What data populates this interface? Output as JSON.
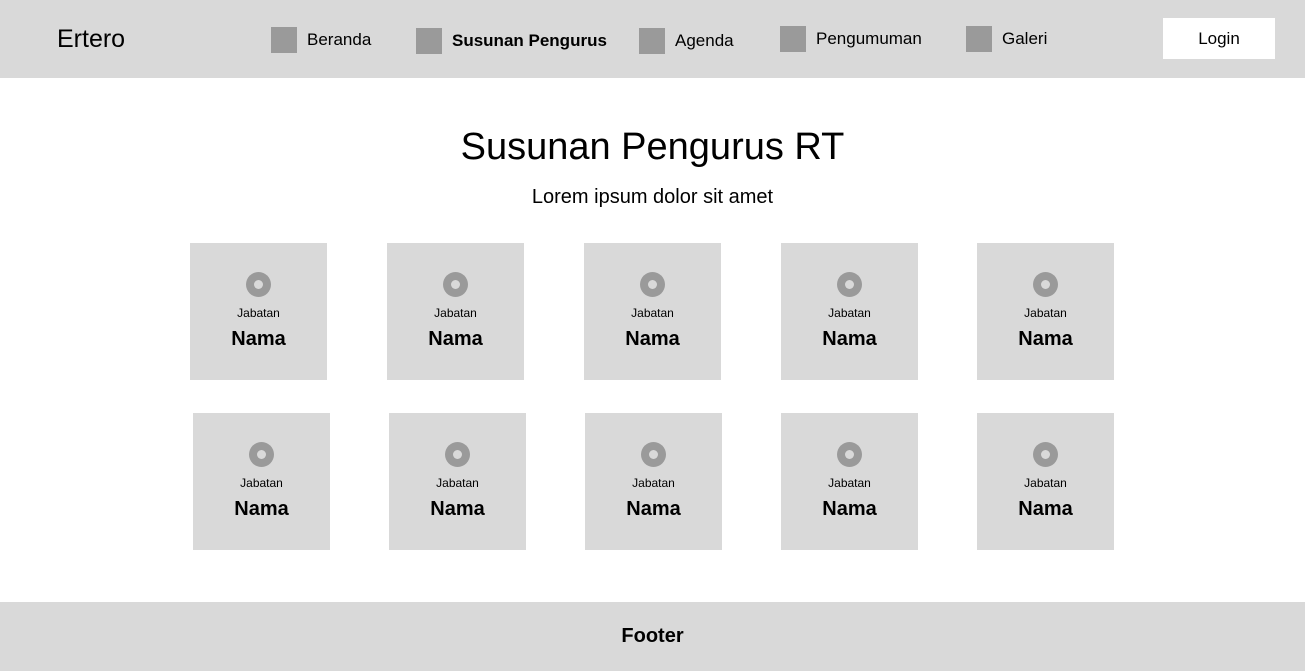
{
  "header": {
    "brand": "Ertero",
    "nav": [
      {
        "label": "Beranda",
        "icon": "placeholder-square-icon",
        "active": false
      },
      {
        "label": "Susunan Pengurus",
        "icon": "placeholder-square-icon",
        "active": true
      },
      {
        "label": "Agenda",
        "icon": "placeholder-square-icon",
        "active": false
      },
      {
        "label": "Pengumuman",
        "icon": "placeholder-square-icon",
        "active": false
      },
      {
        "label": "Galeri",
        "icon": "placeholder-square-icon",
        "active": false
      }
    ],
    "login_label": "Login"
  },
  "main": {
    "title": "Susunan Pengurus RT",
    "subtitle": "Lorem ipsum dolor sit amet",
    "members": [
      {
        "role": "Jabatan",
        "name": "Nama"
      },
      {
        "role": "Jabatan",
        "name": "Nama"
      },
      {
        "role": "Jabatan",
        "name": "Nama"
      },
      {
        "role": "Jabatan",
        "name": "Nama"
      },
      {
        "role": "Jabatan",
        "name": "Nama"
      },
      {
        "role": "Jabatan",
        "name": "Nama"
      },
      {
        "role": "Jabatan",
        "name": "Nama"
      },
      {
        "role": "Jabatan",
        "name": "Nama"
      },
      {
        "role": "Jabatan",
        "name": "Nama"
      },
      {
        "role": "Jabatan",
        "name": "Nama"
      }
    ]
  },
  "footer": {
    "label": "Footer"
  },
  "colors": {
    "header_bg": "#d9d9d9",
    "placeholder": "#9a9a9a",
    "card_bg": "#d9d9d9",
    "page_bg": "#ffffff"
  }
}
